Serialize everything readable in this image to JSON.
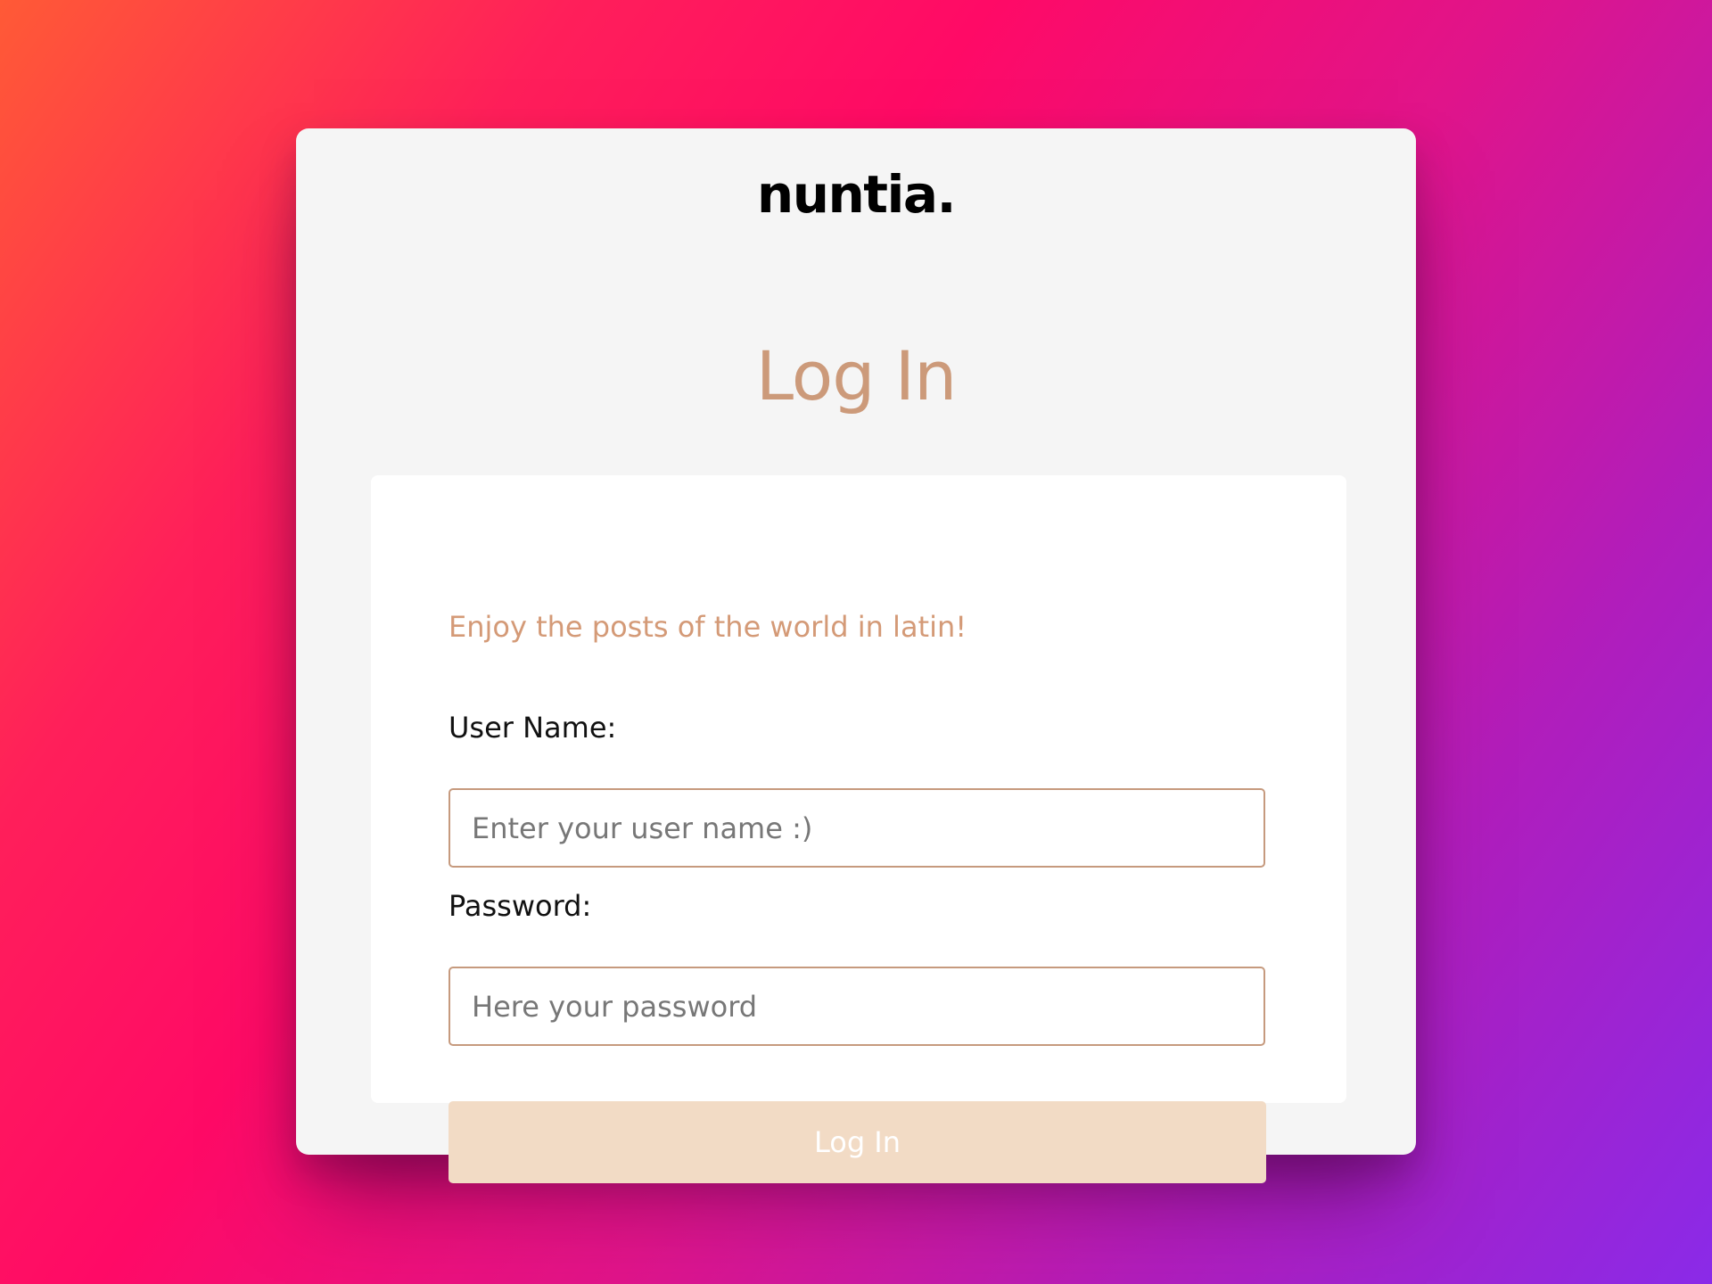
{
  "brand": {
    "logo_text": "nuntia."
  },
  "page": {
    "title": "Log In"
  },
  "form": {
    "tagline": "Enjoy the posts of the world in latin!",
    "username": {
      "label": "User Name:",
      "placeholder": "Enter your user name :)",
      "value": ""
    },
    "password": {
      "label": "Password:",
      "placeholder": "Here your password",
      "value": ""
    },
    "submit_label": "Log In"
  },
  "colors": {
    "accent": "#cc9a7a",
    "button_bg": "#f2dbc5",
    "input_border": "#c69a7e",
    "card_bg": "#f5f5f5",
    "panel_bg": "#ffffff"
  }
}
